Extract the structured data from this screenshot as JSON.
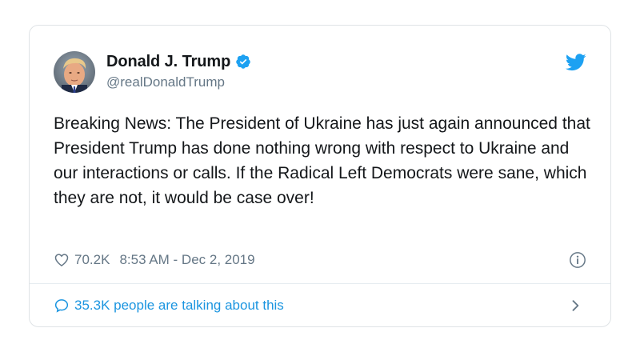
{
  "author": {
    "display_name": "Donald J. Trump",
    "handle": "@realDonaldTrump",
    "verified": true
  },
  "tweet": {
    "text": "Breaking News: The President of Ukraine has just again announced that President Trump has done nothing wrong with respect to Ukraine and our interactions or calls. If the Radical Left Democrats were sane, which they are not, it would be case over!",
    "likes": "70.2K",
    "timestamp": "8:53 AM - Dec 2, 2019"
  },
  "footer": {
    "talking_label": "35.3K people are talking about this"
  },
  "icons": {
    "brand": "twitter-bird-icon",
    "verified": "verified-badge-icon",
    "like": "heart-icon",
    "info": "info-icon",
    "reply": "speech-bubble-icon",
    "chevron": "chevron-right-icon"
  },
  "colors": {
    "brand_blue": "#1da1f2",
    "link_blue": "#1b95e0",
    "text": "#14171a",
    "muted": "#657786",
    "border": "#dfe3e6"
  }
}
